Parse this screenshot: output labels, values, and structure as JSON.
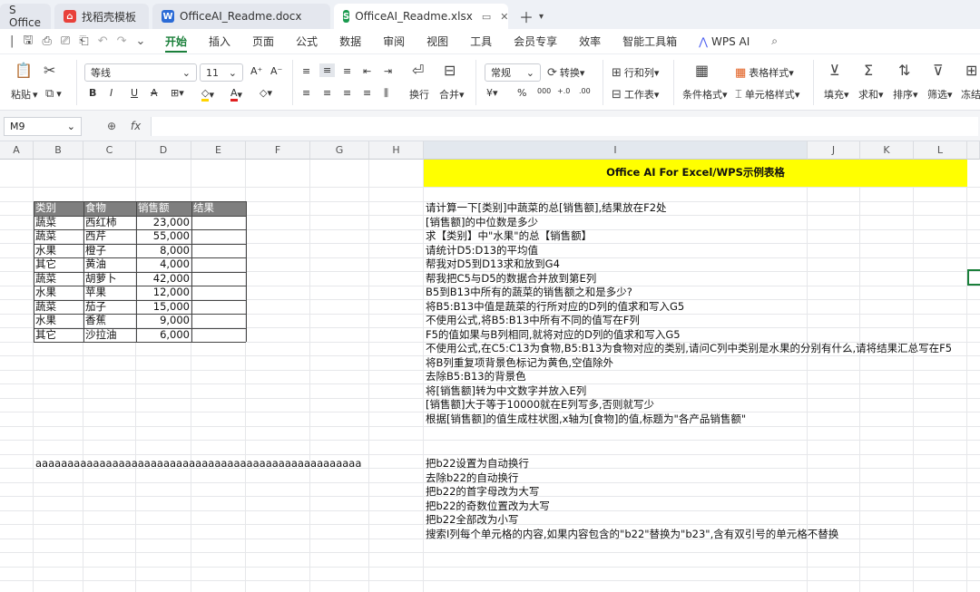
{
  "tabs": [
    {
      "label": "S Office",
      "icon": "wps-office-icon",
      "color": "#e8413a"
    },
    {
      "label": "找稻壳模板",
      "icon": "docer-icon",
      "color": "#e8413a"
    },
    {
      "label": "OfficeAI_Readme.docx",
      "icon": "word-doc-icon",
      "color": "#2b6bd6",
      "glyph": "W"
    },
    {
      "label": "OfficeAI_Readme.xlsx",
      "icon": "sheet-icon",
      "color": "#1a9a4e",
      "glyph": "S"
    }
  ],
  "menu": [
    "开始",
    "插入",
    "页面",
    "公式",
    "数据",
    "审阅",
    "视图",
    "工具",
    "会员专享",
    "效率",
    "智能工具箱",
    "WPS AI"
  ],
  "menu_active": "开始",
  "ribbon": {
    "paste": "粘贴",
    "font_name": "等线",
    "font_size": "11",
    "number_format": "常规",
    "convert": "转换",
    "rows_cols": "行和列",
    "worksheet": "工作表",
    "wrap": "换行",
    "merge": "合并",
    "cond_format": "条件格式",
    "table_style": "表格样式",
    "cell_style": "单元格样式",
    "fill": "填充",
    "sum": "求和",
    "sort": "排序",
    "filter": "筛选",
    "freeze": "冻结"
  },
  "formula_bar": {
    "name_box": "M9",
    "fx": "fx",
    "value": ""
  },
  "columns": [
    "A",
    "B",
    "C",
    "D",
    "E",
    "F",
    "G",
    "H",
    "I",
    "J",
    "K",
    "L"
  ],
  "title_cell": "Office AI For Excel/WPS示例表格",
  "table": {
    "headers": [
      "类别",
      "食物",
      "销售额",
      "结果"
    ],
    "rows": [
      [
        "蔬菜",
        "西红柿",
        "23,000"
      ],
      [
        "蔬菜",
        "西芹",
        "55,000"
      ],
      [
        "水果",
        "橙子",
        "8,000"
      ],
      [
        "其它",
        "黄油",
        "4,000"
      ],
      [
        "蔬菜",
        "胡萝卜",
        "42,000"
      ],
      [
        "水果",
        "苹果",
        "12,000"
      ],
      [
        "蔬菜",
        "茄子",
        "15,000"
      ],
      [
        "水果",
        "香蕉",
        "9,000"
      ],
      [
        "其它",
        "沙拉油",
        "6,000"
      ]
    ]
  },
  "b22": "aaaaaaaaaaaaaaaaaaaaaaaaaaaaaaaaaaaaaaaaaaaaaaaaaaa",
  "instructions": [
    "请计算一下[类别]中蔬菜的总[销售额],结果放在F2处",
    "[销售额]的中位数是多少",
    "求【类别】中\"水果\"的总【销售额】",
    "请统计D5:D13的平均值",
    "帮我对D5到D13求和放到G4",
    "帮我把C5与D5的数据合并放到第E列",
    "B5到B13中所有的蔬菜的销售额之和是多少?",
    "将B5:B13中值是蔬菜的行所对应的D列的值求和写入G5",
    "不使用公式,将B5:B13中所有不同的值写在F列",
    "F5的值如果与B列相同,就将对应的D列的值求和写入G5",
    "不使用公式,在C5:C13为食物,B5:B13为食物对应的类别,请问C列中类别是水果的分别有什么,请将结果汇总写在F5",
    "将B列重复项背景色标记为黄色,空值除外",
    "去除B5:B13的背景色",
    "将[销售额]转为中文数字并放入E列",
    "[销售额]大于等于10000就在E列写多,否则就写少",
    "根据[销售额]的值生成柱状图,x轴为[食物]的值,标题为\"各产品销售额\""
  ],
  "instructions2": [
    "把b22设置为自动换行",
    "去除b22的自动换行",
    "把b22的首字母改为大写",
    "把b22的奇数位置改为大写",
    "把b22全部改为小写",
    "搜索I列每个单元格的内容,如果内容包含的\"b22\"替换为\"b23\",含有双引号的单元格不替换"
  ],
  "colors": {
    "accent": "#1a7f3a",
    "title_bg": "#ffff00",
    "table_header_bg": "#7f7f7f"
  }
}
